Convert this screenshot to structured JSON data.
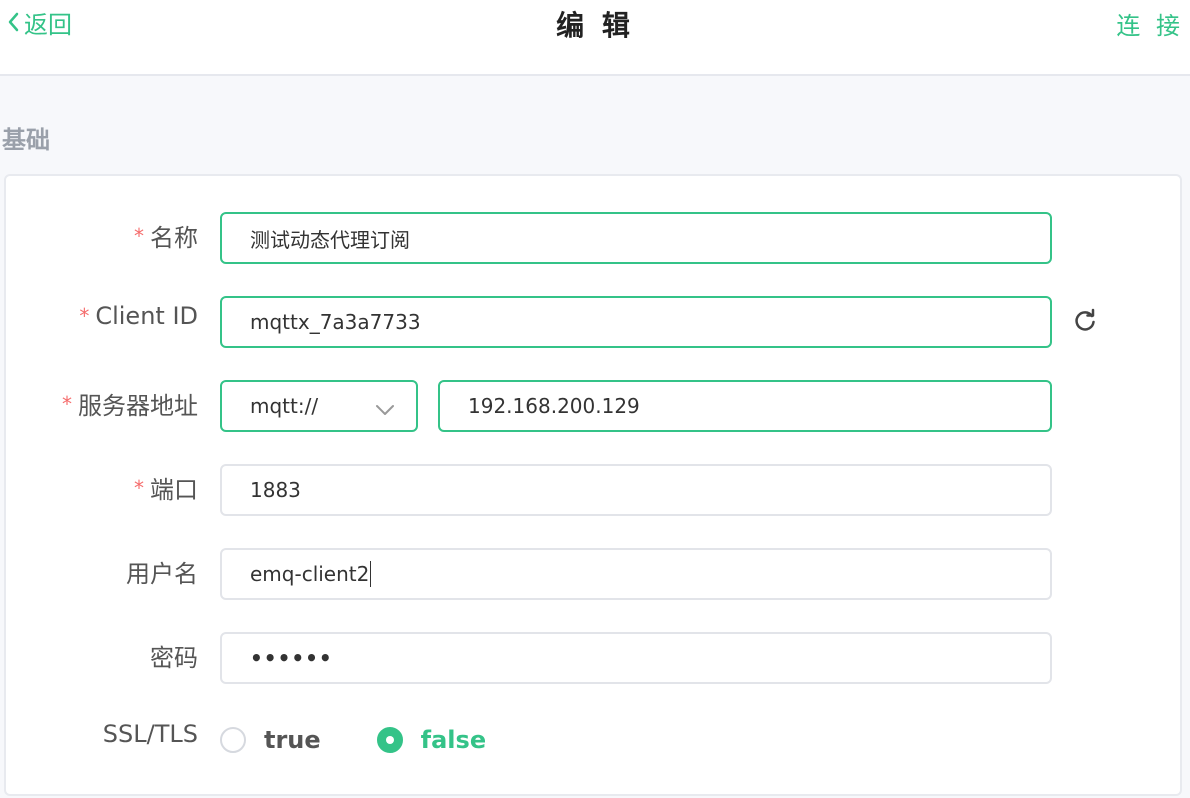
{
  "header": {
    "back_label": "返回",
    "title": "编 辑",
    "connect_label": "连 接"
  },
  "section": {
    "title": "基础"
  },
  "form": {
    "name": {
      "label": "名称",
      "value": "测试动态代理订阅",
      "required": true
    },
    "client_id": {
      "label": "Client ID",
      "value": "mqttx_7a3a7733",
      "required": true
    },
    "server": {
      "label": "服务器地址",
      "protocol": "mqtt://",
      "host": "192.168.200.129",
      "required": true
    },
    "port": {
      "label": "端口",
      "value": "1883",
      "required": true
    },
    "username": {
      "label": "用户名",
      "value": "emq-client2"
    },
    "password": {
      "label": "密码",
      "value": "••••••"
    },
    "ssl": {
      "label": "SSL/TLS",
      "options": [
        "true",
        "false"
      ],
      "selected": "false"
    }
  },
  "colors": {
    "accent": "#34c388",
    "required": "#f56c6c"
  },
  "icons": {
    "back": "chevron-left-icon",
    "refresh": "refresh-icon",
    "dropdown": "chevron-down-icon"
  }
}
